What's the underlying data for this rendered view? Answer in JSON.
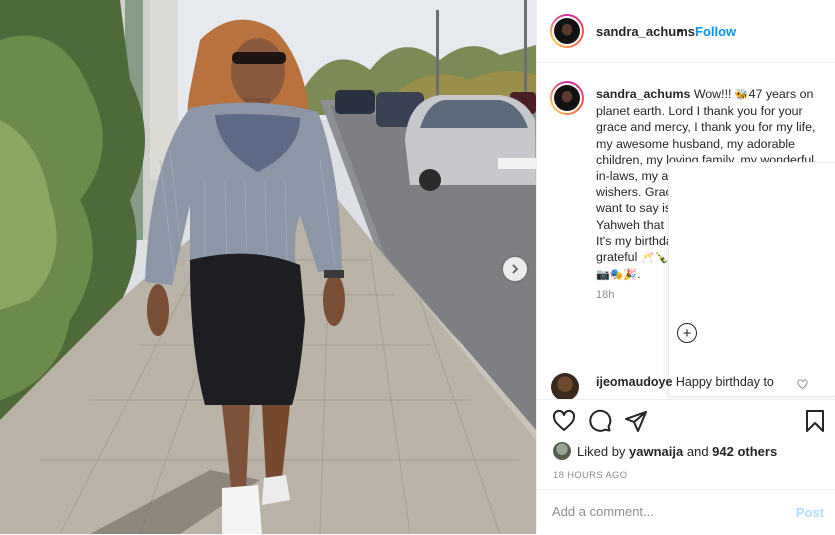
{
  "post": {
    "username": "sandra_achums",
    "dot": "•",
    "follow_label": "Follow"
  },
  "caption": {
    "username": "sandra_achums",
    "text_part1": "Wow!!! ",
    "emoji1": "🐝",
    "text_part2": "47 years on planet earth. Lord I thank you for your grace and mercy, I thank you for my life, my awesome husband, my adorable children, my loving family, my wonderful in-laws, my amazing friends and well wishers. Gracious and glorious lord, all I want to say is thank you. It's only you Yahweh that made everything possible. It's my birthday and i will be forever grateful ",
    "emoji2": "🥂🍾🏡",
    "emoji3": "📷🎭🎉",
    "time": "18h"
  },
  "comment": {
    "username": "ijeomaudoye",
    "text": "Happy birthday to"
  },
  "likes": {
    "prefix": "Liked by ",
    "user": "yawnaija",
    "and": " and ",
    "count": "942 others"
  },
  "timestamp": "18 HOURS AGO",
  "add_comment": {
    "placeholder": "Add a comment...",
    "post_label": "Post"
  },
  "icons": {
    "like": "heart-icon",
    "comment": "comment-bubble-icon",
    "share": "paper-plane-icon",
    "save": "bookmark-icon",
    "next": "chevron-right-icon",
    "add": "plus-circle-icon"
  },
  "colors": {
    "link": "#0095f6",
    "post_disabled": "#b2dffc",
    "muted": "#8e8e8e",
    "text": "#262626"
  }
}
